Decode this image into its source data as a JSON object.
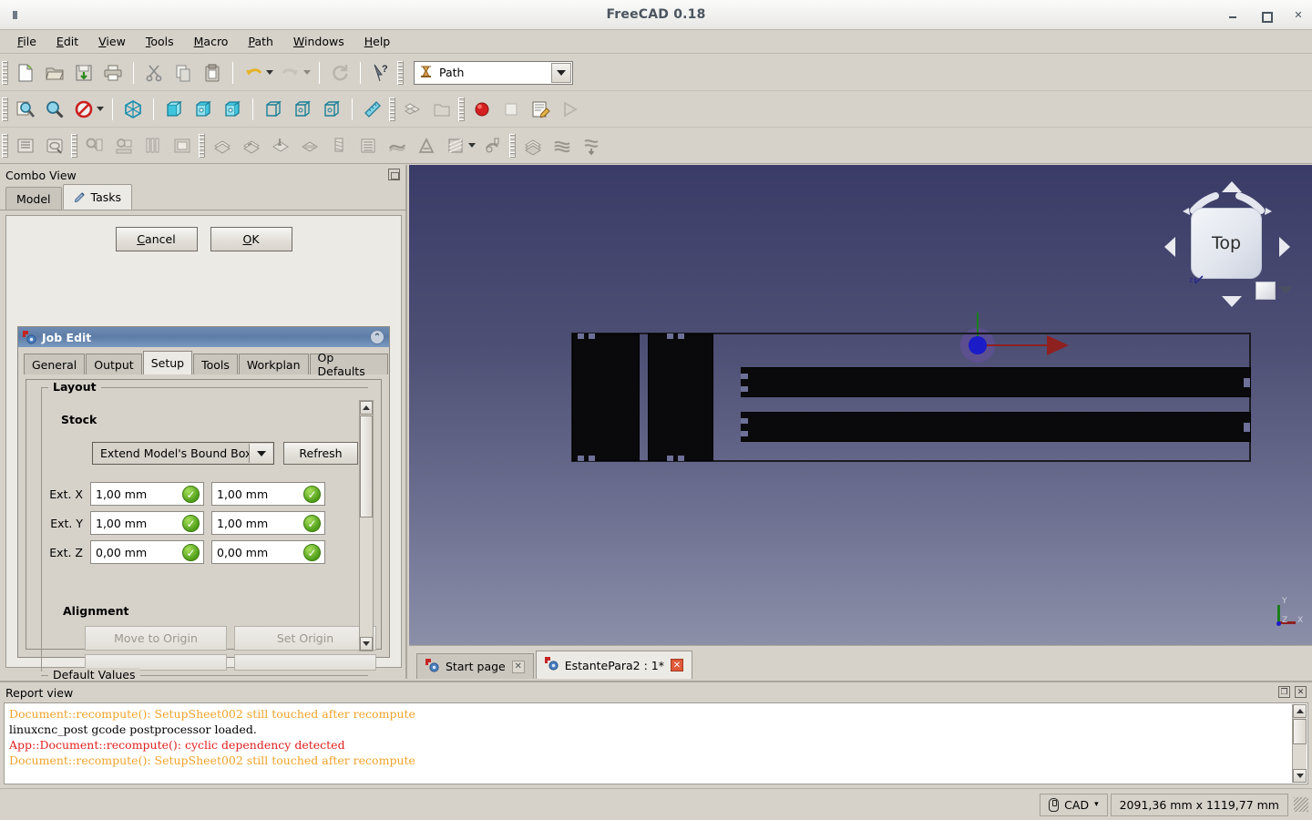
{
  "window": {
    "title": "FreeCAD 0.18",
    "buttons": {
      "minimize": "minimize",
      "maximize": "maximize",
      "close": "close"
    }
  },
  "menubar": {
    "items": [
      {
        "label": "File",
        "accel": "F"
      },
      {
        "label": "Edit",
        "accel": "E"
      },
      {
        "label": "View",
        "accel": "V"
      },
      {
        "label": "Tools",
        "accel": "T"
      },
      {
        "label": "Macro",
        "accel": "M"
      },
      {
        "label": "Path",
        "accel": "P"
      },
      {
        "label": "Windows",
        "accel": "W"
      },
      {
        "label": "Help",
        "accel": "H"
      }
    ]
  },
  "toolbars": {
    "workbench_selector": {
      "value": "Path",
      "icon": "path-workbench-icon"
    },
    "file_group": [
      "new-document-icon",
      "open-document-icon",
      "save-document-icon",
      "print-document-icon"
    ],
    "edit_group": [
      "cut-icon",
      "copy-icon",
      "paste-icon",
      "undo-icon",
      "redo-icon",
      "refresh-icon",
      "whats-this-icon"
    ],
    "view_group": [
      "fit-all-icon",
      "fit-selection-icon",
      "draw-style-icon",
      "isometric-view-icon",
      "front-view-icon",
      "top-view-icon",
      "right-view-icon",
      "rear-view-icon",
      "bottom-view-icon",
      "left-view-icon",
      "measure-icon"
    ],
    "structure_group": [
      "create-part-icon",
      "create-group-icon"
    ],
    "macro_group": [
      "macro-record-icon",
      "macro-stop-icon",
      "macro-edit-icon",
      "macro-execute-icon"
    ],
    "path_group": [
      "job-create-icon",
      "job-edit-icon",
      "inspect-gcode-icon",
      "simulator-icon",
      "toolbit-library-icon",
      "toolbit-dock-icon"
    ],
    "path_ops_group": [
      "profile-icon",
      "pocket-shape-icon",
      "drilling-icon",
      "face-icon",
      "helix-icon",
      "adaptive-icon",
      "surface-icon",
      "engrave-icon",
      "deburr-icon",
      "vcarve-icon",
      "slot-icon"
    ],
    "path_mod_group": [
      "array-icon",
      "copy-op-icon",
      "simple-copy-icon"
    ]
  },
  "combo_view": {
    "title": "Combo View",
    "undock_icon": "undock-icon",
    "tabs": [
      {
        "label": "Model",
        "icon": "",
        "active": false
      },
      {
        "label": "Tasks",
        "icon": "pencil-icon",
        "active": true
      }
    ],
    "task_buttons": [
      {
        "label": "Cancel",
        "accel": "C"
      },
      {
        "label": "OK",
        "accel": "O"
      }
    ],
    "job_edit": {
      "title": "Job Edit",
      "icon": "freecad-gear-icon",
      "collapse_icon": "chevron-up-icon",
      "tabs": [
        {
          "label": "General",
          "active": false
        },
        {
          "label": "Output",
          "active": false
        },
        {
          "label": "Setup",
          "active": true
        },
        {
          "label": "Tools",
          "active": false
        },
        {
          "label": "Workplan",
          "active": false
        },
        {
          "label": "Op Defaults",
          "active": false
        }
      ],
      "setup": {
        "layout_group": "Layout",
        "stock_label": "Stock",
        "stock_type": "Extend Model's Bound Box",
        "refresh_label": "Refresh",
        "extents": [
          {
            "label": "Ext. X",
            "neg": "1,00 mm",
            "pos": "1,00 mm",
            "neg_valid": true,
            "pos_valid": true
          },
          {
            "label": "Ext. Y",
            "neg": "1,00 mm",
            "pos": "1,00 mm",
            "neg_valid": true,
            "pos_valid": true
          },
          {
            "label": "Ext. Z",
            "neg": "0,00 mm",
            "pos": "0,00 mm",
            "neg_valid": true,
            "pos_valid": true
          }
        ],
        "alignment_label": "Alignment",
        "alignment_buttons": [
          {
            "label": "Move to Origin",
            "enabled": false
          },
          {
            "label": "Set Origin",
            "enabled": false
          }
        ],
        "default_values_group": "Default Values"
      }
    }
  },
  "view3d": {
    "navigation_cube": {
      "face_label": "Top",
      "arrows": [
        "nav-arrow-up",
        "nav-arrow-down",
        "nav-arrow-left",
        "nav-arrow-right",
        "nav-arc-left",
        "nav-arc-right"
      ],
      "mini_cube": "nav-mini-cube-icon",
      "mini_dropdown": "nav-mini-dropdown-icon"
    },
    "axis_cross": {
      "x": "X",
      "y": "Y",
      "z": "Z"
    },
    "origin_marker": {
      "name": "origin-marker"
    },
    "model": {
      "name": "cnc-panel-model"
    }
  },
  "document_tabs": [
    {
      "label": "Start page",
      "icon": "freecad-gear-icon",
      "active": false,
      "close_icon": "close-icon",
      "close_style": "grey"
    },
    {
      "label": "EstantePara2 : 1*",
      "icon": "freecad-gear-icon",
      "active": true,
      "close_icon": "close-icon",
      "close_style": "red"
    }
  ],
  "report_view": {
    "title": "Report view",
    "undock_icon": "undock-icon",
    "close_icon": "close-icon",
    "lines": [
      {
        "text": "Document::recompute(): SetupSheet002 still touched after recompute",
        "color": "#f0a32a"
      },
      {
        "text": "linuxcnc_post gcode postprocessor loaded.",
        "color": "#000000"
      },
      {
        "text": "App::Document::recompute(): cyclic dependency detected",
        "color": "#e02020"
      },
      {
        "text": "Document::recompute(): SetupSheet002 still touched after recompute",
        "color": "#f0a32a"
      }
    ]
  },
  "statusbar": {
    "navigation_style": {
      "label": "CAD",
      "icon": "mouse-icon",
      "dropdown": "▾"
    },
    "dimensions": "2091,36 mm x 1119,77 mm"
  },
  "colors": {
    "accent_blue": "#5d7ca6",
    "panel_bg": "#d6d2ca",
    "view_top": "#3a3c68",
    "view_bottom": "#8c8fa8",
    "valid_green": "#4f9e18",
    "warn_orange": "#f0a32a",
    "error_red": "#e02020"
  }
}
